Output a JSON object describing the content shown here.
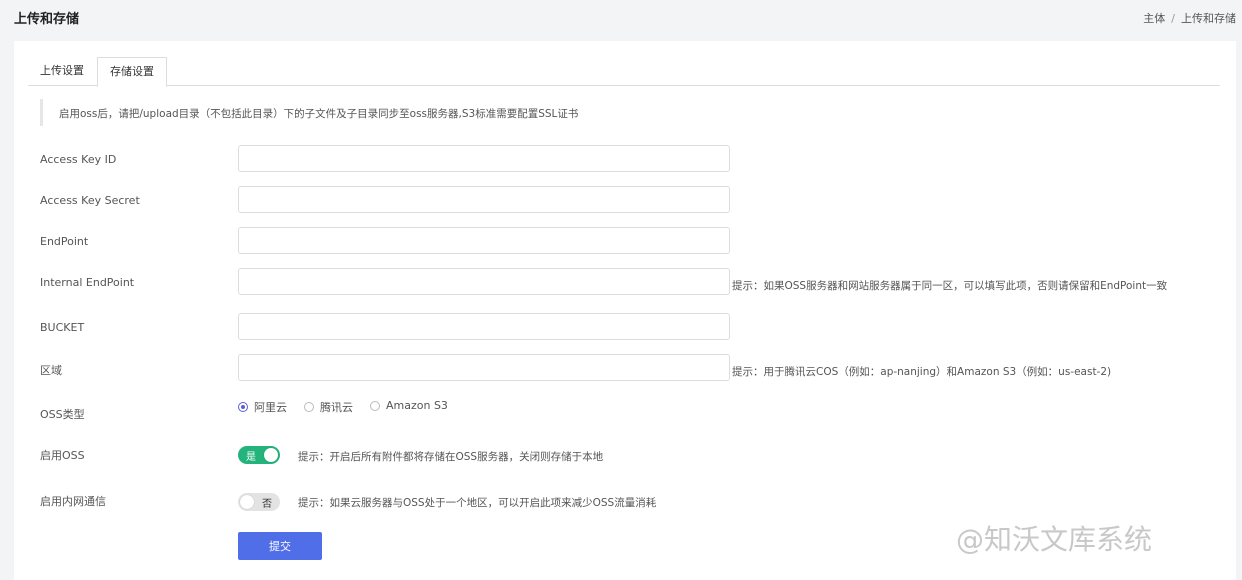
{
  "header": {
    "title": "上传和存储",
    "breadcrumb": [
      "主体",
      "/",
      "上传和存储"
    ]
  },
  "tabs": [
    {
      "label": "上传设置",
      "active": false
    },
    {
      "label": "存储设置",
      "active": true
    }
  ],
  "notice": "启用oss后，请把/upload目录（不包括此目录）下的子文件及子目录同步至oss服务器,S3标准需要配置SSL证书",
  "fields": [
    {
      "label": "Access Key ID",
      "value": ""
    },
    {
      "label": "Access Key Secret",
      "value": ""
    },
    {
      "label": "EndPoint",
      "value": ""
    },
    {
      "label": "Internal EndPoint",
      "value": "",
      "hint": "提示：如果OSS服务器和网站服务器属于同一区，可以填写此项，否则请保留和EndPoint一致"
    },
    {
      "label": "BUCKET",
      "value": ""
    },
    {
      "label": "区域",
      "value": "",
      "hint": "提示：用于腾讯云COS（例如：ap-nanjing）和Amazon S3（例如：us-east-2)"
    }
  ],
  "oss_type": {
    "label": "OSS类型",
    "options": [
      "阿里云",
      "腾讯云",
      "Amazon S3"
    ],
    "selected": "阿里云"
  },
  "enable_oss": {
    "label": "启用OSS",
    "state": "on",
    "text": "是",
    "hint": "提示：开启后所有附件都将存储在OSS服务器，关闭则存储于本地"
  },
  "enable_intranet": {
    "label": "启用内网通信",
    "state": "off",
    "text": "否",
    "hint": "提示：如果云服务器与OSS处于一个地区，可以开启此项来减少OSS流量消耗"
  },
  "submit_label": "提交",
  "watermark": "@知沃文库系统",
  "colors": {
    "accent": "#4f6ee8",
    "switch_on": "#23b37b",
    "radio": "#5a5fd6"
  }
}
